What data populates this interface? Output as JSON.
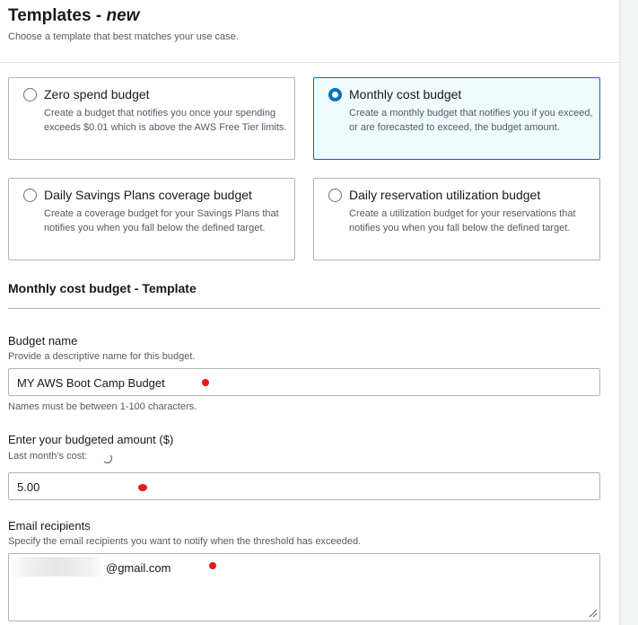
{
  "templates": {
    "title": "Templates - ",
    "title_badge": "new",
    "subtitle": "Choose a template that best matches your use case."
  },
  "cards": [
    {
      "title": "Zero spend budget",
      "description": "Create a budget that notifies you once your spending exceeds $0.01 which is above the AWS Free Tier limits.",
      "selected": false
    },
    {
      "title": "Monthly cost budget",
      "description": "Create a monthly budget that notifies you if you exceed, or are forecasted to exceed, the budget amount.",
      "selected": true
    },
    {
      "title": "Daily Savings Plans coverage budget",
      "description": "Create a coverage budget for your Savings Plans that notifies you when you fall below the defined target.",
      "selected": false
    },
    {
      "title": "Daily reservation utilization budget",
      "description": "Create a utilization budget for your reservations that notifies you when you fall below the defined target.",
      "selected": false
    }
  ],
  "form": {
    "section_title": "Monthly cost budget - Template",
    "budget_name": {
      "label": "Budget name",
      "description": "Provide a descriptive name for this budget.",
      "value": "MY AWS Boot Camp Budget",
      "constraint": "Names must be between 1-100 characters."
    },
    "amount": {
      "label": "Enter your budgeted amount ($)",
      "last_month_label": "Last month's cost:",
      "value": "5.00"
    },
    "email": {
      "label": "Email recipients",
      "description": "Specify the email recipients you want to notify when the threshold has exceeded.",
      "value_visible": "@gmail.com"
    }
  },
  "colors": {
    "selected_border": "#0073bb",
    "selected_bg": "#f1faff",
    "annotation_dot": "#e31a1c"
  }
}
